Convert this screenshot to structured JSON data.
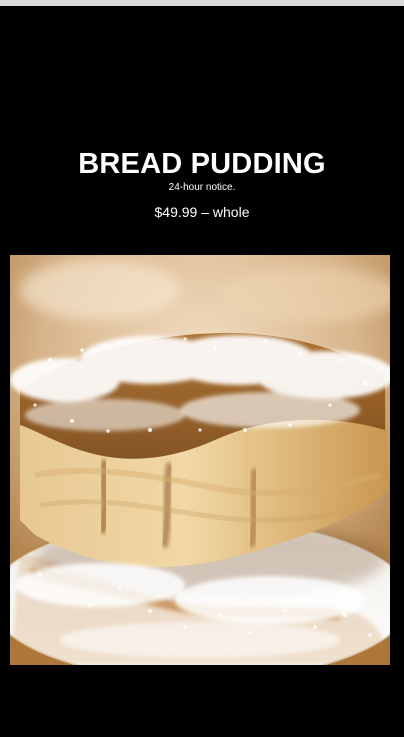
{
  "product": {
    "title": "BREAD PUDDING",
    "notice": "24-hour notice.",
    "price": "$49.99 – whole"
  },
  "photo": {
    "subject": "bread-pudding-photo"
  },
  "colors": {
    "background": "#000000",
    "text": "#ffffff"
  }
}
